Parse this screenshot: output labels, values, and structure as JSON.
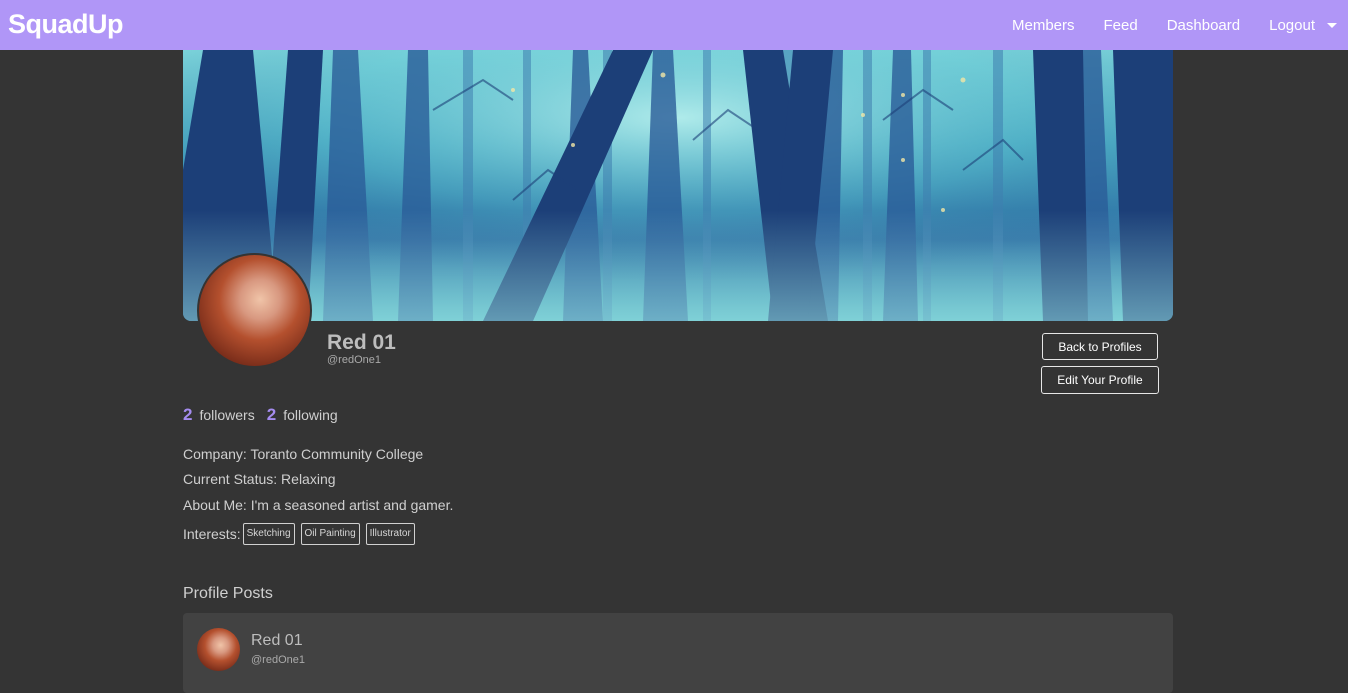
{
  "nav": {
    "brand": "SquadUp",
    "links": [
      "Members",
      "Feed",
      "Dashboard",
      "Logout"
    ]
  },
  "profile": {
    "name": "Red 01",
    "handle": "@redOne1",
    "followers_count": "2",
    "followers_label": "followers",
    "following_count": "2",
    "following_label": "following",
    "company": "Company: Toranto Community College",
    "status": "Current Status: Relaxing",
    "about": "About Me: I'm a seasoned artist and gamer.",
    "interests_label": "Interests:",
    "interests": [
      "Sketching",
      "Oil Painting",
      "Illustrator"
    ]
  },
  "buttons": {
    "back": "Back to Profiles",
    "edit": "Edit Your Profile"
  },
  "posts": {
    "title": "Profile Posts",
    "items": [
      {
        "name": "Red 01",
        "handle": "@redOne1"
      }
    ]
  },
  "colors": {
    "navbar": "#b096f7",
    "accent": "#a58cf0",
    "background": "#343434",
    "card": "#424242"
  }
}
